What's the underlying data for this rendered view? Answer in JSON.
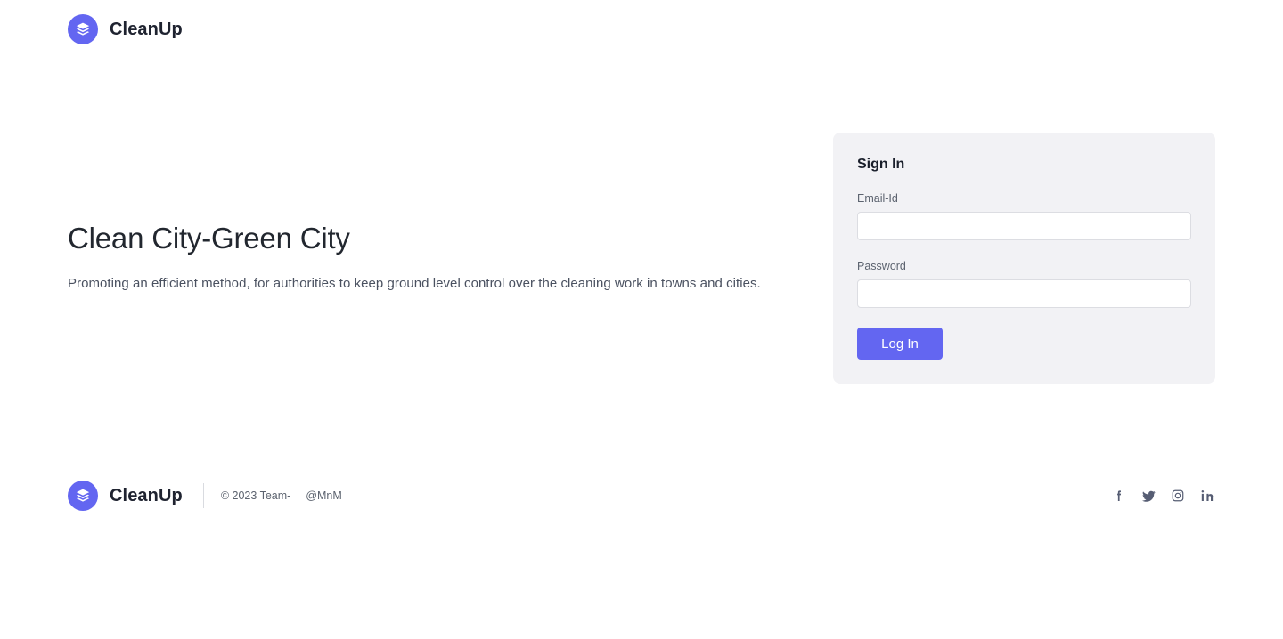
{
  "header": {
    "brand_name": "CleanUp",
    "logo_icon": "layers-stack-icon",
    "logo_color": "#6366f1"
  },
  "hero": {
    "title": "Clean City-Green City",
    "subtitle": "Promoting an efficient method, for authorities to keep ground level control over the cleaning work in towns and cities."
  },
  "signin": {
    "title": "Sign In",
    "email": {
      "label": "Email-Id",
      "value": "",
      "placeholder": ""
    },
    "password": {
      "label": "Password",
      "value": "",
      "placeholder": ""
    },
    "submit_label": "Log In",
    "accent_color": "#6366f1",
    "card_background": "#f2f2f5"
  },
  "footer": {
    "brand_name": "CleanUp",
    "copyright": "© 2023 Team-",
    "handle": "@MnM",
    "social": [
      {
        "name": "facebook",
        "icon": "facebook-icon"
      },
      {
        "name": "twitter",
        "icon": "twitter-icon"
      },
      {
        "name": "instagram",
        "icon": "instagram-icon"
      },
      {
        "name": "linkedin",
        "icon": "linkedin-icon"
      }
    ]
  }
}
